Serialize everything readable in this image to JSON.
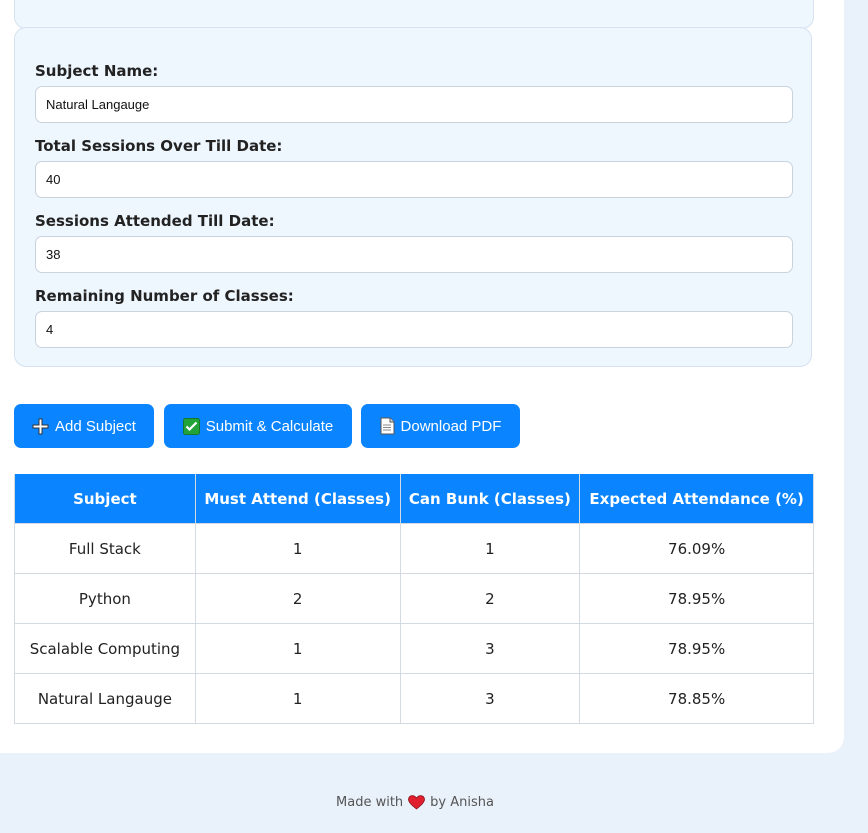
{
  "form": {
    "subject_name_label": "Subject Name:",
    "subject_name_value": "Natural Langauge",
    "total_sessions_label": "Total Sessions Over Till Date:",
    "total_sessions_value": "40",
    "attended_label": "Sessions Attended Till Date:",
    "attended_value": "38",
    "remaining_label": "Remaining Number of Classes:",
    "remaining_value": "4"
  },
  "actions": {
    "add_label": "Add Subject",
    "add_icon": "plus-icon",
    "submit_label": "Submit & Calculate",
    "submit_icon": "check-box-icon",
    "download_label": "Download PDF",
    "download_icon": "document-icon"
  },
  "table": {
    "headers": [
      "Subject",
      "Must Attend (Classes)",
      "Can Bunk (Classes)",
      "Expected Attendance (%)"
    ],
    "rows": [
      [
        "Full Stack",
        "1",
        "1",
        "76.09%"
      ],
      [
        "Python",
        "2",
        "2",
        "78.95%"
      ],
      [
        "Scalable Computing",
        "1",
        "3",
        "78.95%"
      ],
      [
        "Natural Langauge",
        "1",
        "3",
        "78.85%"
      ]
    ]
  },
  "footer": {
    "prefix": "Made with",
    "icon": "heart-icon",
    "suffix": "by Anisha"
  },
  "colors": {
    "accent": "#0a84ff",
    "page_background": "#e9f1fb",
    "subject_box_background": "#eef6fe",
    "heart": "#e0202e",
    "check_green": "#22a33a"
  }
}
